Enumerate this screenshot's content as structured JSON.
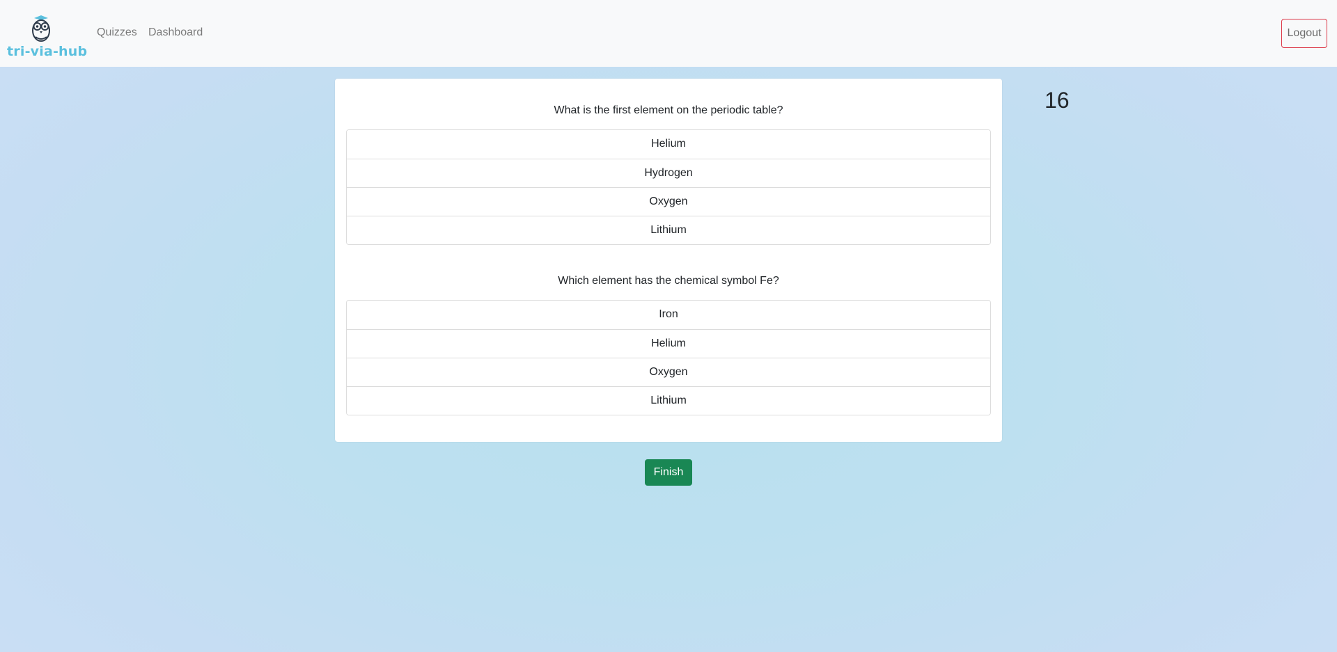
{
  "navbar": {
    "brand_text": "tri-via-hub",
    "logo_icon": "owl-icon",
    "links": [
      {
        "label": "Quizzes"
      },
      {
        "label": "Dashboard"
      }
    ],
    "logout_label": "Logout"
  },
  "timer": {
    "value": "16"
  },
  "quiz": {
    "questions": [
      {
        "text": "What is the first element on the periodic table?",
        "answers": [
          "Helium",
          "Hydrogen",
          "Oxygen",
          "Lithium"
        ]
      },
      {
        "text": "Which element has the chemical symbol Fe?",
        "answers": [
          "Iron",
          "Helium",
          "Oxygen",
          "Lithium"
        ]
      }
    ],
    "finish_label": "Finish"
  },
  "colors": {
    "brand": "#5bc0de",
    "finish": "#198754",
    "logout_border": "#dc3545",
    "navbar_bg": "#f8f9fa"
  }
}
